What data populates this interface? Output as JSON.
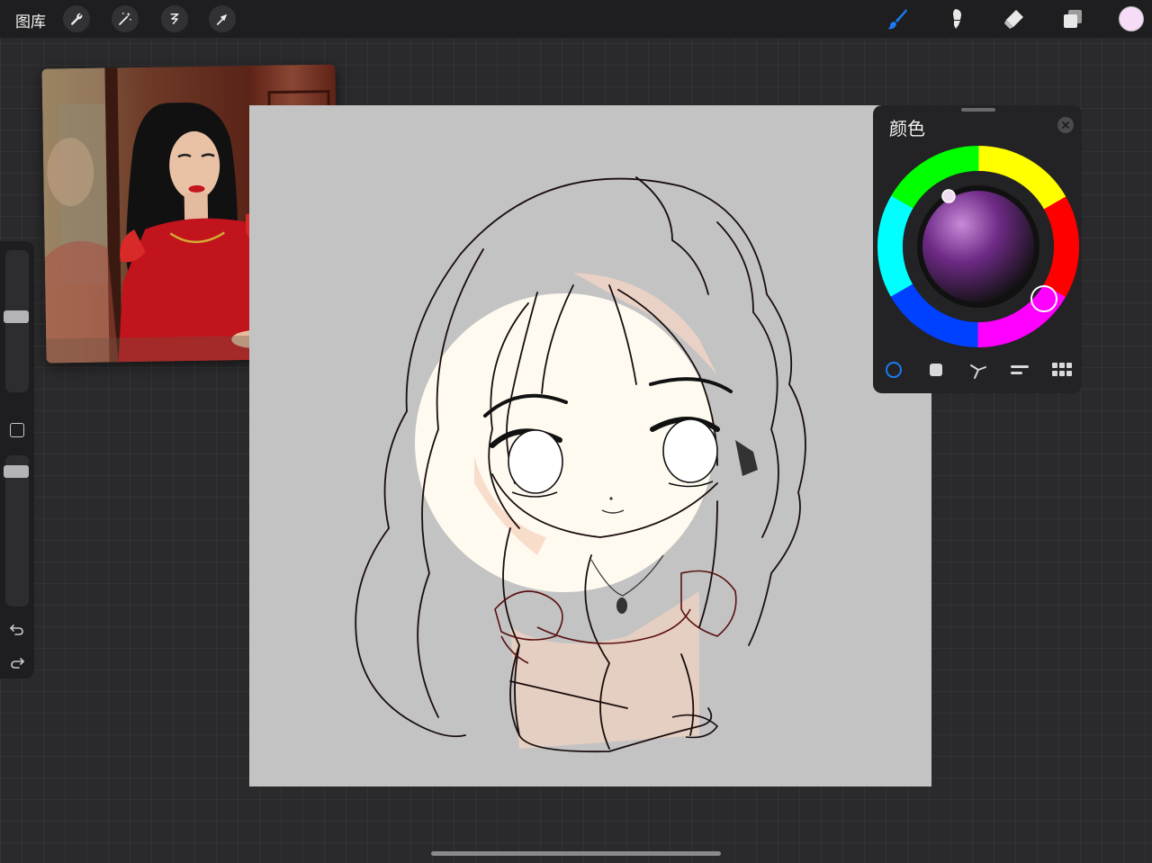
{
  "toolbar": {
    "gallery_label": "图库",
    "left_tools": [
      "wrench-icon",
      "magic-wand-icon",
      "selection-icon",
      "transform-arrow-icon"
    ],
    "right_tools": [
      "brush-icon",
      "smudge-icon",
      "eraser-icon",
      "layers-icon"
    ],
    "active_tool": "brush",
    "accent_color": "#1a7cf5",
    "current_color": "#f6dcf6"
  },
  "sidebar": {
    "brush_size_level": 0.5,
    "opacity_level": 0.9,
    "undo_icon": "undo-icon",
    "redo_icon": "redo-icon"
  },
  "color_panel": {
    "title": "颜色",
    "modes": [
      "disc",
      "classic",
      "harmony",
      "value",
      "palettes"
    ],
    "active_mode": "disc",
    "selected_color": "#f6dcf6"
  },
  "canvas": {
    "background": "#c3c3c3"
  },
  "reference": {
    "dress_color": "#c2141c",
    "hair_color": "#111111"
  }
}
